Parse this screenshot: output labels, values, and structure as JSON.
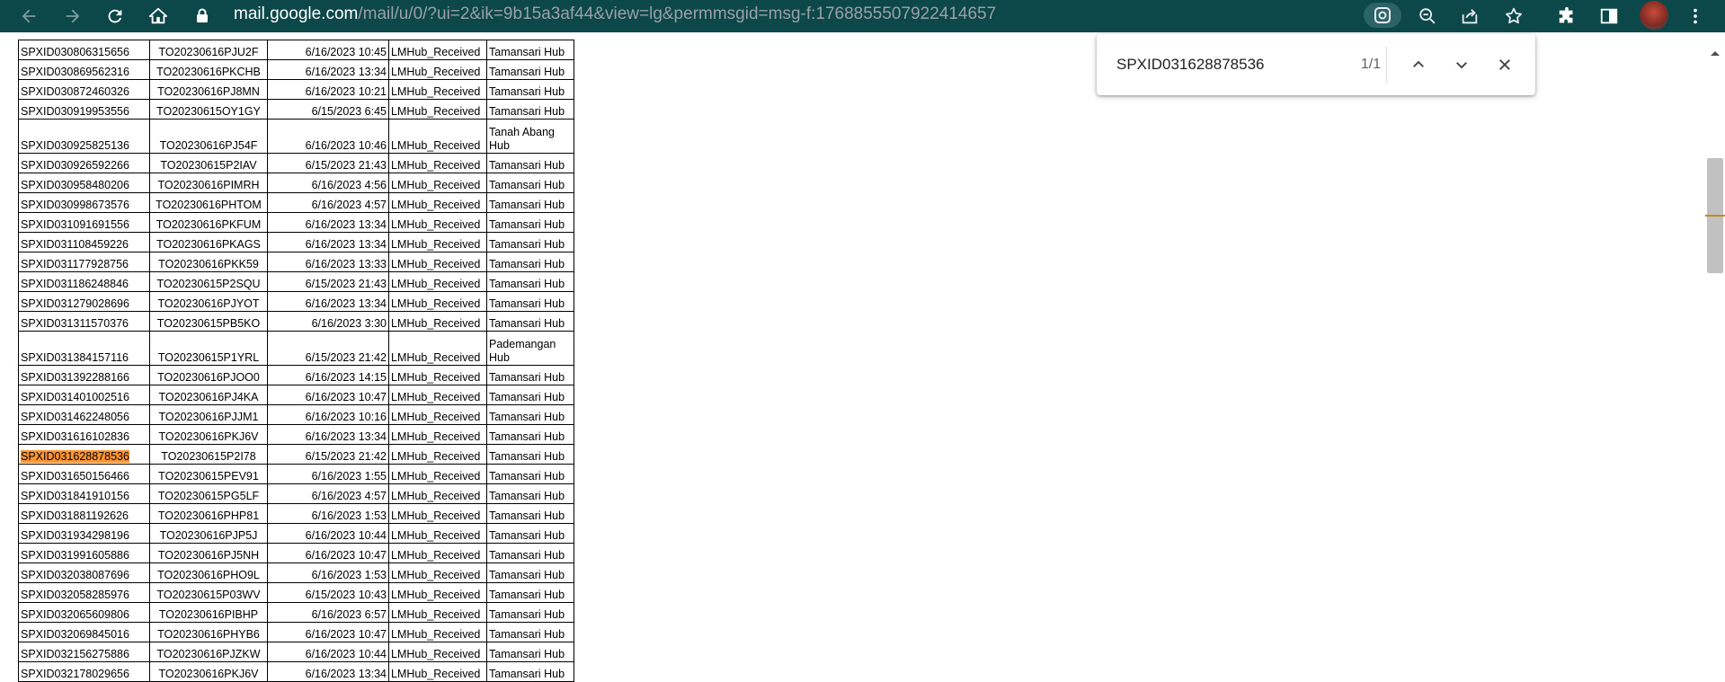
{
  "browser": {
    "url_host": "mail.google.com",
    "url_path": "/mail/u/0/?ui=2&ik=9b15a3af44&view=lg&permmsgid=msg-f:1768855507922414657",
    "toolbar_color": "#0c4749"
  },
  "find_bar": {
    "query": "SPXID031628878536",
    "match_count": "1/1"
  },
  "sheet": {
    "rows": [
      {
        "id": "SPXID030806315656",
        "to": "TO20230616PJU2F",
        "datetime": "6/16/2023 10:45",
        "status": "LMHub_Received",
        "hub": [
          "Tamansari Hub"
        ]
      },
      {
        "id": "SPXID030869562316",
        "to": "TO20230616PKCHB",
        "datetime": "6/16/2023 13:34",
        "status": "LMHub_Received",
        "hub": [
          "Tamansari Hub"
        ]
      },
      {
        "id": "SPXID030872460326",
        "to": "TO20230616PJ8MN",
        "datetime": "6/16/2023 10:21",
        "status": "LMHub_Received",
        "hub": [
          "Tamansari Hub"
        ]
      },
      {
        "id": "SPXID030919953556",
        "to": "TO20230615OY1GY",
        "datetime": "6/15/2023 6:45",
        "status": "LMHub_Received",
        "hub": [
          "Tamansari Hub"
        ]
      },
      {
        "id": "SPXID030925825136",
        "to": "TO20230616PJ54F",
        "datetime": "6/16/2023 10:46",
        "status": "LMHub_Received",
        "hub": [
          "Tanah Abang",
          "Hub"
        ]
      },
      {
        "id": "SPXID030926592266",
        "to": "TO20230615P2IAV",
        "datetime": "6/15/2023 21:43",
        "status": "LMHub_Received",
        "hub": [
          "Tamansari Hub"
        ]
      },
      {
        "id": "SPXID030958480206",
        "to": "TO20230616PIMRH",
        "datetime": "6/16/2023 4:56",
        "status": "LMHub_Received",
        "hub": [
          "Tamansari Hub"
        ]
      },
      {
        "id": "SPXID030998673576",
        "to": "TO20230616PHTOM",
        "datetime": "6/16/2023 4:57",
        "status": "LMHub_Received",
        "hub": [
          "Tamansari Hub"
        ]
      },
      {
        "id": "SPXID031091691556",
        "to": "TO20230616PKFUM",
        "datetime": "6/16/2023 13:34",
        "status": "LMHub_Received",
        "hub": [
          "Tamansari Hub"
        ]
      },
      {
        "id": "SPXID031108459226",
        "to": "TO20230616PKAGS",
        "datetime": "6/16/2023 13:34",
        "status": "LMHub_Received",
        "hub": [
          "Tamansari Hub"
        ]
      },
      {
        "id": "SPXID031177928756",
        "to": "TO20230616PKK59",
        "datetime": "6/16/2023 13:33",
        "status": "LMHub_Received",
        "hub": [
          "Tamansari Hub"
        ]
      },
      {
        "id": "SPXID031186248846",
        "to": "TO20230615P2SQU",
        "datetime": "6/15/2023 21:43",
        "status": "LMHub_Received",
        "hub": [
          "Tamansari Hub"
        ]
      },
      {
        "id": "SPXID031279028696",
        "to": "TO20230616PJYOT",
        "datetime": "6/16/2023 13:34",
        "status": "LMHub_Received",
        "hub": [
          "Tamansari Hub"
        ]
      },
      {
        "id": "SPXID031311570376",
        "to": "TO20230615PB5KO",
        "datetime": "6/16/2023 3:30",
        "status": "LMHub_Received",
        "hub": [
          "Tamansari Hub"
        ]
      },
      {
        "id": "SPXID031384157116",
        "to": "TO20230615P1YRL",
        "datetime": "6/15/2023 21:42",
        "status": "LMHub_Received",
        "hub": [
          "Pademangan",
          "Hub"
        ]
      },
      {
        "id": "SPXID031392288166",
        "to": "TO20230616PJOO0",
        "datetime": "6/16/2023 14:15",
        "status": "LMHub_Received",
        "hub": [
          "Tamansari Hub"
        ]
      },
      {
        "id": "SPXID031401002516",
        "to": "TO20230616PJ4KA",
        "datetime": "6/16/2023 10:47",
        "status": "LMHub_Received",
        "hub": [
          "Tamansari Hub"
        ]
      },
      {
        "id": "SPXID031462248056",
        "to": "TO20230616PJJM1",
        "datetime": "6/16/2023 10:16",
        "status": "LMHub_Received",
        "hub": [
          "Tamansari Hub"
        ]
      },
      {
        "id": "SPXID031616102836",
        "to": "TO20230616PKJ6V",
        "datetime": "6/16/2023 13:34",
        "status": "LMHub_Received",
        "hub": [
          "Tamansari Hub"
        ]
      },
      {
        "id": "SPXID031628878536",
        "to": "TO20230615P2I78",
        "datetime": "6/15/2023 21:42",
        "status": "LMHub_Received",
        "hub": [
          "Tamansari Hub"
        ],
        "highlighted": true
      },
      {
        "id": "SPXID031650156466",
        "to": "TO20230615PEV91",
        "datetime": "6/16/2023 1:55",
        "status": "LMHub_Received",
        "hub": [
          "Tamansari Hub"
        ]
      },
      {
        "id": "SPXID031841910156",
        "to": "TO20230615PG5LF",
        "datetime": "6/16/2023 4:57",
        "status": "LMHub_Received",
        "hub": [
          "Tamansari Hub"
        ]
      },
      {
        "id": "SPXID031881192626",
        "to": "TO20230616PHP81",
        "datetime": "6/16/2023 1:53",
        "status": "LMHub_Received",
        "hub": [
          "Tamansari Hub"
        ]
      },
      {
        "id": "SPXID031934298196",
        "to": "TO20230616PJP5J",
        "datetime": "6/16/2023 10:44",
        "status": "LMHub_Received",
        "hub": [
          "Tamansari Hub"
        ]
      },
      {
        "id": "SPXID031991605886",
        "to": "TO20230616PJ5NH",
        "datetime": "6/16/2023 10:47",
        "status": "LMHub_Received",
        "hub": [
          "Tamansari Hub"
        ]
      },
      {
        "id": "SPXID032038087696",
        "to": "TO20230616PHO9L",
        "datetime": "6/16/2023 1:53",
        "status": "LMHub_Received",
        "hub": [
          "Tamansari Hub"
        ]
      },
      {
        "id": "SPXID032058285976",
        "to": "TO20230615P03WV",
        "datetime": "6/15/2023 10:43",
        "status": "LMHub_Received",
        "hub": [
          "Tamansari Hub"
        ]
      },
      {
        "id": "SPXID032065609806",
        "to": "TO20230616PIBHP",
        "datetime": "6/16/2023 6:57",
        "status": "LMHub_Received",
        "hub": [
          "Tamansari Hub"
        ]
      },
      {
        "id": "SPXID032069845016",
        "to": "TO20230616PHYB6",
        "datetime": "6/16/2023 10:47",
        "status": "LMHub_Received",
        "hub": [
          "Tamansari Hub"
        ]
      },
      {
        "id": "SPXID032156275886",
        "to": "TO20230616PJZKW",
        "datetime": "6/16/2023 10:44",
        "status": "LMHub_Received",
        "hub": [
          "Tamansari Hub"
        ]
      },
      {
        "id": "SPXID032178029656",
        "to": "TO20230616PKJ6V",
        "datetime": "6/16/2023 13:34",
        "status": "LMHub_Received",
        "hub": [
          "Tamansari Hub"
        ]
      }
    ]
  },
  "colors": {
    "highlight": "#ff9632",
    "scroll_mark": "#c58a1e"
  },
  "icons": {
    "back": "arrow-left-icon",
    "forward": "arrow-right-icon",
    "reload": "reload-icon",
    "home": "home-icon",
    "lock": "lock-icon",
    "lens": "google-lens-icon",
    "zoom": "zoom-out-icon",
    "share": "share-icon",
    "bookmark": "star-icon",
    "extensions": "puzzle-icon",
    "side_panel": "side-panel-icon",
    "menu": "kebab-menu-icon"
  }
}
